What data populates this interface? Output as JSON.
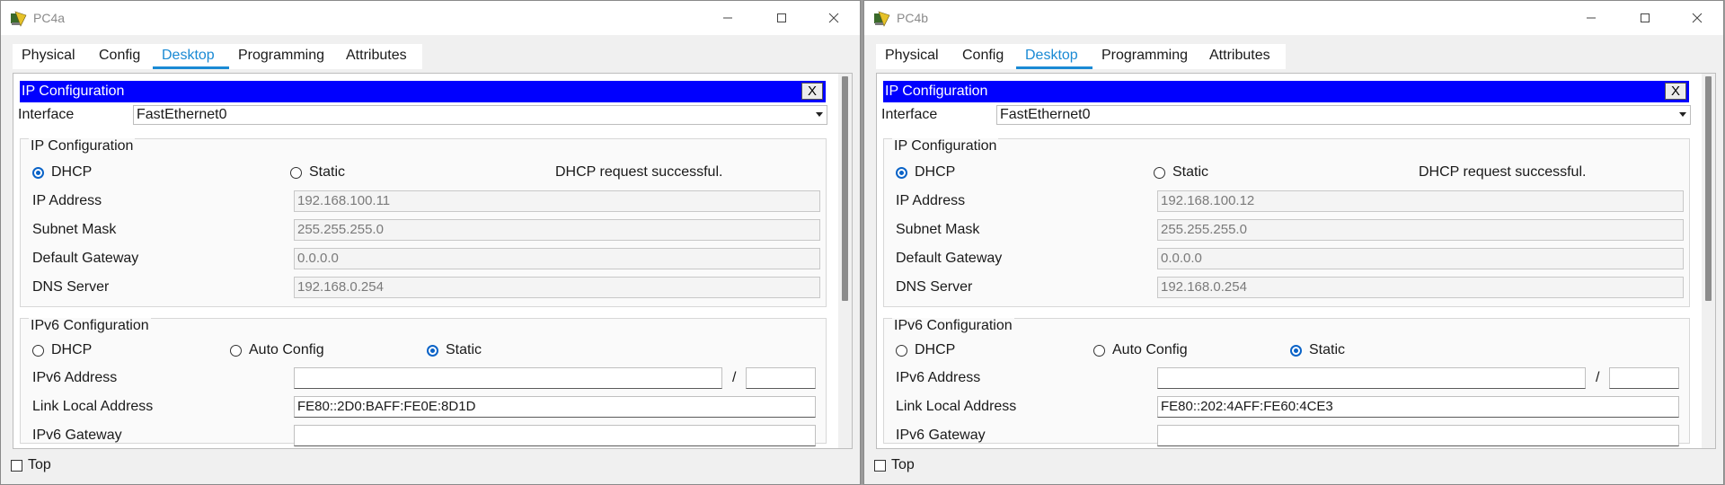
{
  "windows": [
    {
      "title": "PC4a",
      "tabs": [
        "Physical",
        "Config",
        "Desktop",
        "Programming",
        "Attributes"
      ],
      "active_tab": "Desktop",
      "header": {
        "title": "IP Configuration",
        "close": "X"
      },
      "interface": {
        "label": "Interface",
        "value": "FastEthernet0"
      },
      "ipv4": {
        "group_label": "IP Configuration",
        "mode_dhcp": "DHCP",
        "mode_static": "Static",
        "selected": "DHCP",
        "status": "DHCP request successful.",
        "ip_label": "IP Address",
        "ip": "192.168.100.11",
        "mask_label": "Subnet Mask",
        "mask": "255.255.255.0",
        "gw_label": "Default Gateway",
        "gw": "0.0.0.0",
        "dns_label": "DNS Server",
        "dns": "192.168.0.254"
      },
      "ipv6": {
        "group_label": "IPv6 Configuration",
        "mode_dhcp": "DHCP",
        "mode_auto": "Auto Config",
        "mode_static": "Static",
        "selected": "Static",
        "addr_label": "IPv6 Address",
        "addr": "",
        "slash": "/",
        "prefix": "",
        "link_label": "Link Local Address",
        "link": "FE80::2D0:BAFF:FE0E:8D1D",
        "gw_label": "IPv6 Gateway",
        "gw": ""
      },
      "top": {
        "label": "Top",
        "checked": false
      }
    },
    {
      "title": "PC4b",
      "tabs": [
        "Physical",
        "Config",
        "Desktop",
        "Programming",
        "Attributes"
      ],
      "active_tab": "Desktop",
      "header": {
        "title": "IP Configuration",
        "close": "X"
      },
      "interface": {
        "label": "Interface",
        "value": "FastEthernet0"
      },
      "ipv4": {
        "group_label": "IP Configuration",
        "mode_dhcp": "DHCP",
        "mode_static": "Static",
        "selected": "DHCP",
        "status": "DHCP request successful.",
        "ip_label": "IP Address",
        "ip": "192.168.100.12",
        "mask_label": "Subnet Mask",
        "mask": "255.255.255.0",
        "gw_label": "Default Gateway",
        "gw": "0.0.0.0",
        "dns_label": "DNS Server",
        "dns": "192.168.0.254"
      },
      "ipv6": {
        "group_label": "IPv6 Configuration",
        "mode_dhcp": "DHCP",
        "mode_auto": "Auto Config",
        "mode_static": "Static",
        "selected": "Static",
        "addr_label": "IPv6 Address",
        "addr": "",
        "slash": "/",
        "prefix": "",
        "link_label": "Link Local Address",
        "link": "FE80::202:4AFF:FE60:4CE3",
        "gw_label": "IPv6 Gateway",
        "gw": ""
      },
      "top": {
        "label": "Top",
        "checked": false
      }
    }
  ],
  "colors": {
    "header_bar": "#0000ff",
    "active_tab": "#1a8ad4",
    "radio_selected": "#0a63c7"
  },
  "icons": {
    "app": "packet-tracer-pc-icon",
    "minimize": "minimize-icon",
    "maximize": "maximize-icon",
    "close": "close-icon"
  }
}
